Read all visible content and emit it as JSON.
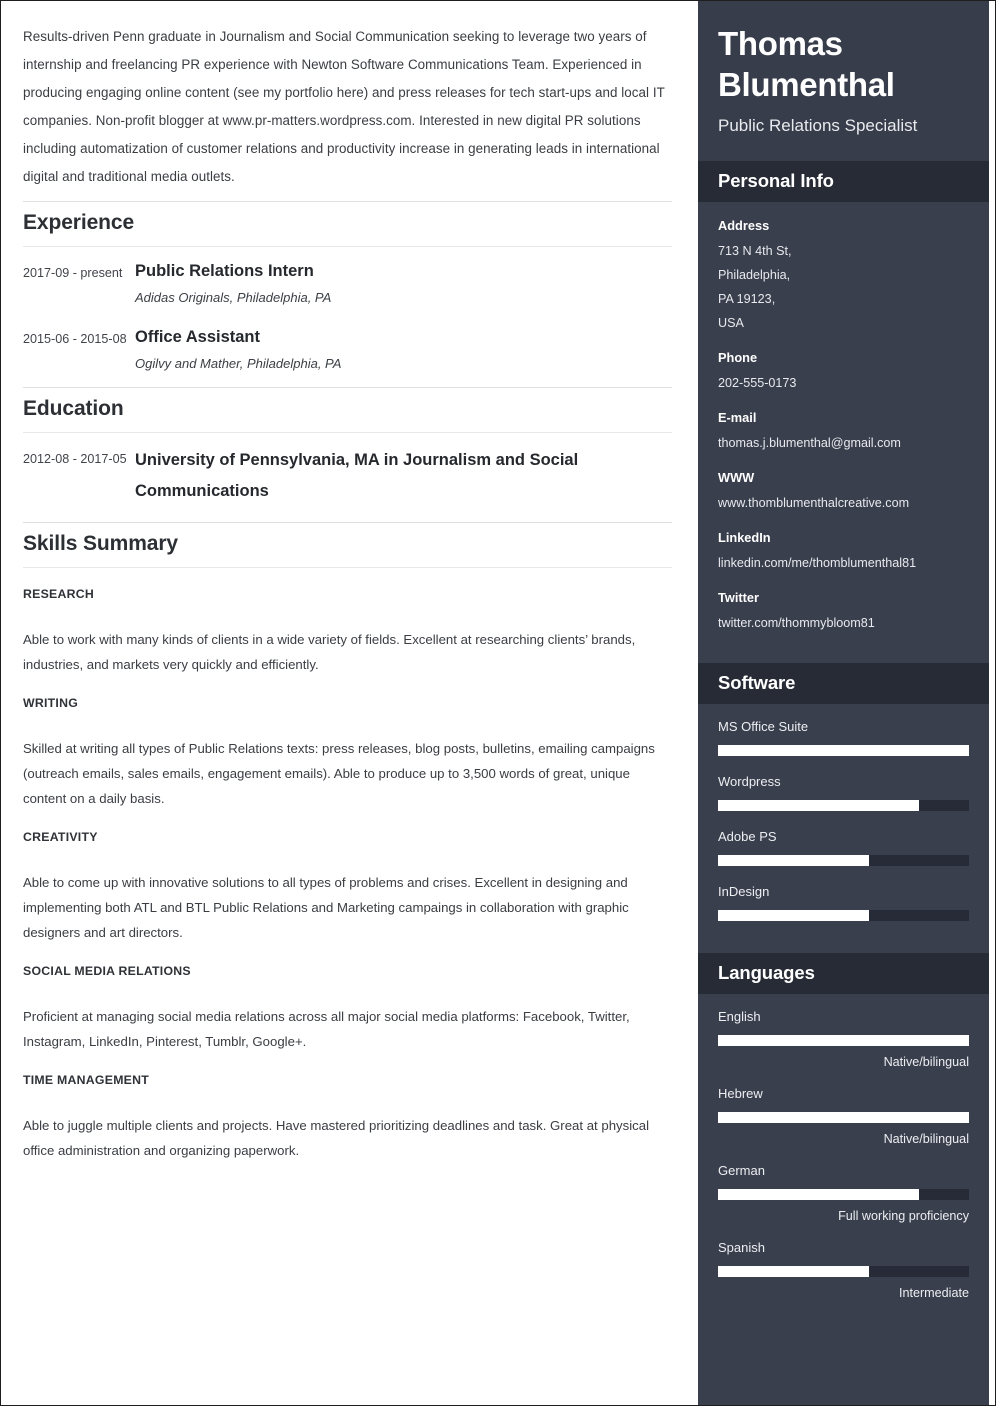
{
  "colors": {
    "sidebar_bg": "#3a3f4d",
    "sidebar_header_bg": "#373d4a",
    "section_bar_bg": "#272b35",
    "bar_track": "#272b37",
    "bar_fill": "#ffffff",
    "page_bg": "#ffffff",
    "text": "#33363b"
  },
  "main": {
    "summary": "Results-driven Penn graduate in Journalism and Social Communication seeking to leverage two years of internship and freelancing PR experience with Newton Software Communications Team. Experienced in producing engaging online content (see my portfolio here) and press releases for tech start-ups and local IT companies. Non-profit blogger at www.pr-matters.wordpress.com. Interested in new digital PR solutions including automatization of customer relations and productivity increase in generating leads in international digital and traditional media outlets.",
    "experience": {
      "title": "Experience",
      "entries": [
        {
          "date": "2017-09 - present",
          "role": "Public Relations Intern",
          "org": "Adidas Originals, Philadelphia, PA"
        },
        {
          "date": "2015-06 - 2015-08",
          "role": "Office Assistant",
          "org": "Ogilvy and Mather, Philadelphia, PA"
        }
      ]
    },
    "education": {
      "title": "Education",
      "entries": [
        {
          "date": "2012-08 - 2017-05",
          "role": "University of Pennsylvania, MA in Journalism and Social Communications"
        }
      ]
    },
    "skills": {
      "title": "Skills Summary",
      "items": [
        {
          "name": "RESEARCH",
          "desc": "Able to work with many kinds of clients in a wide variety of fields. Excellent at researching clients’ brands, industries, and markets very quickly and efficiently."
        },
        {
          "name": "WRITING",
          "desc": "Skilled at writing all types of Public Relations texts: press releases, blog posts, bulletins, emailing campaigns (outreach emails, sales emails, engagement emails). Able to produce up to 3,500 words of great, unique content on a daily basis."
        },
        {
          "name": "CREATIVITY",
          "desc": "Able to come up with innovative solutions to all types of problems and crises. Excellent in designing and implementing both ATL and BTL Public Relations and Marketing campaings in collaboration with graphic designers and art directors."
        },
        {
          "name": "SOCIAL MEDIA RELATIONS",
          "desc": "Proficient at managing social media relations across all major social media platforms: Facebook, Twitter, Instagram, LinkedIn, Pinterest, Tumblr, Google+."
        },
        {
          "name": "TIME MANAGEMENT",
          "desc": "Able to juggle multiple clients and projects. Have mastered prioritizing deadlines and task. Great at physical office administration and organizing paperwork."
        }
      ]
    }
  },
  "sidebar": {
    "name": "Thomas Blumenthal",
    "role": "Public Relations Specialist",
    "personal_info": {
      "title": "Personal Info",
      "items": [
        {
          "label": "Address",
          "lines": [
            "713 N 4th St,",
            "Philadelphia,",
            "PA 19123,",
            "USA"
          ]
        },
        {
          "label": "Phone",
          "lines": [
            "202-555-0173"
          ]
        },
        {
          "label": "E-mail",
          "lines": [
            "thomas.j.blumenthal@gmail.com"
          ]
        },
        {
          "label": "WWW",
          "lines": [
            "www.thomblumenthalcreative.com"
          ]
        },
        {
          "label": "LinkedIn",
          "lines": [
            "linkedin.com/me/thomblumenthal81"
          ]
        },
        {
          "label": "Twitter",
          "lines": [
            "twitter.com/thommybloom81"
          ]
        }
      ]
    },
    "software": {
      "title": "Software",
      "items": [
        {
          "name": "MS Office Suite",
          "level_pct": 100
        },
        {
          "name": "Wordpress",
          "level_pct": 80
        },
        {
          "name": "Adobe PS",
          "level_pct": 60
        },
        {
          "name": "InDesign",
          "level_pct": 60
        }
      ]
    },
    "languages": {
      "title": "Languages",
      "items": [
        {
          "name": "English",
          "level_pct": 100,
          "level_label": "Native/bilingual"
        },
        {
          "name": "Hebrew",
          "level_pct": 100,
          "level_label": "Native/bilingual"
        },
        {
          "name": "German",
          "level_pct": 80,
          "level_label": "Full working proficiency"
        },
        {
          "name": "Spanish",
          "level_pct": 60,
          "level_label": "Intermediate"
        }
      ]
    }
  }
}
